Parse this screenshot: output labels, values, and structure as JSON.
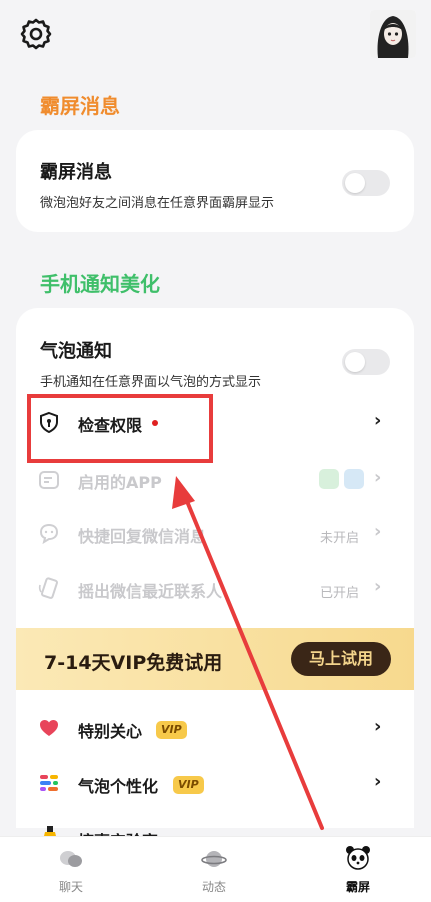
{
  "header": {
    "settings_icon": "gear-icon",
    "avatar": "avatar"
  },
  "section_overlay": {
    "title": "霸屏消息",
    "item_title": "霸屏消息",
    "item_desc": "微泡泡好友之间消息在任意界面霸屏显示",
    "toggle_on": false
  },
  "section_notify": {
    "title": "手机通知美化",
    "bubble_title": "气泡通知",
    "bubble_desc": "手机通知在任意界面以气泡的方式显示",
    "bubble_toggle_on": false,
    "rows": [
      {
        "label": "检查权限",
        "icon": "shield-icon",
        "status": ""
      },
      {
        "label": "启用的APP",
        "icon": "app-list-icon",
        "status": ""
      },
      {
        "label": "快捷回复微信消息",
        "icon": "chat-icon",
        "status": "未开启"
      },
      {
        "label": "摇出微信最近联系人",
        "icon": "shake-icon",
        "status": "已开启"
      }
    ]
  },
  "vip_banner": {
    "text": "7-14天VIP免费试用",
    "button": "马上试用"
  },
  "vip_rows": [
    {
      "label": "特别关心",
      "icon": "heart-icon",
      "tag": "VIP"
    },
    {
      "label": "气泡个性化",
      "icon": "palette-icon",
      "tag": "VIP"
    },
    {
      "label": "搞事实验室",
      "icon": "lab-icon",
      "tag": "VIP"
    }
  ],
  "tabbar": {
    "tabs": [
      {
        "label": "聊天",
        "icon": "chat-bubbles-icon"
      },
      {
        "label": "动态",
        "icon": "planet-icon"
      },
      {
        "label": "霸屏",
        "icon": "panda-icon",
        "active": true
      }
    ]
  },
  "colors": {
    "accent_orange": "#f08c2e",
    "accent_green": "#3fbf6a",
    "annotation_red": "#e83c3c"
  }
}
